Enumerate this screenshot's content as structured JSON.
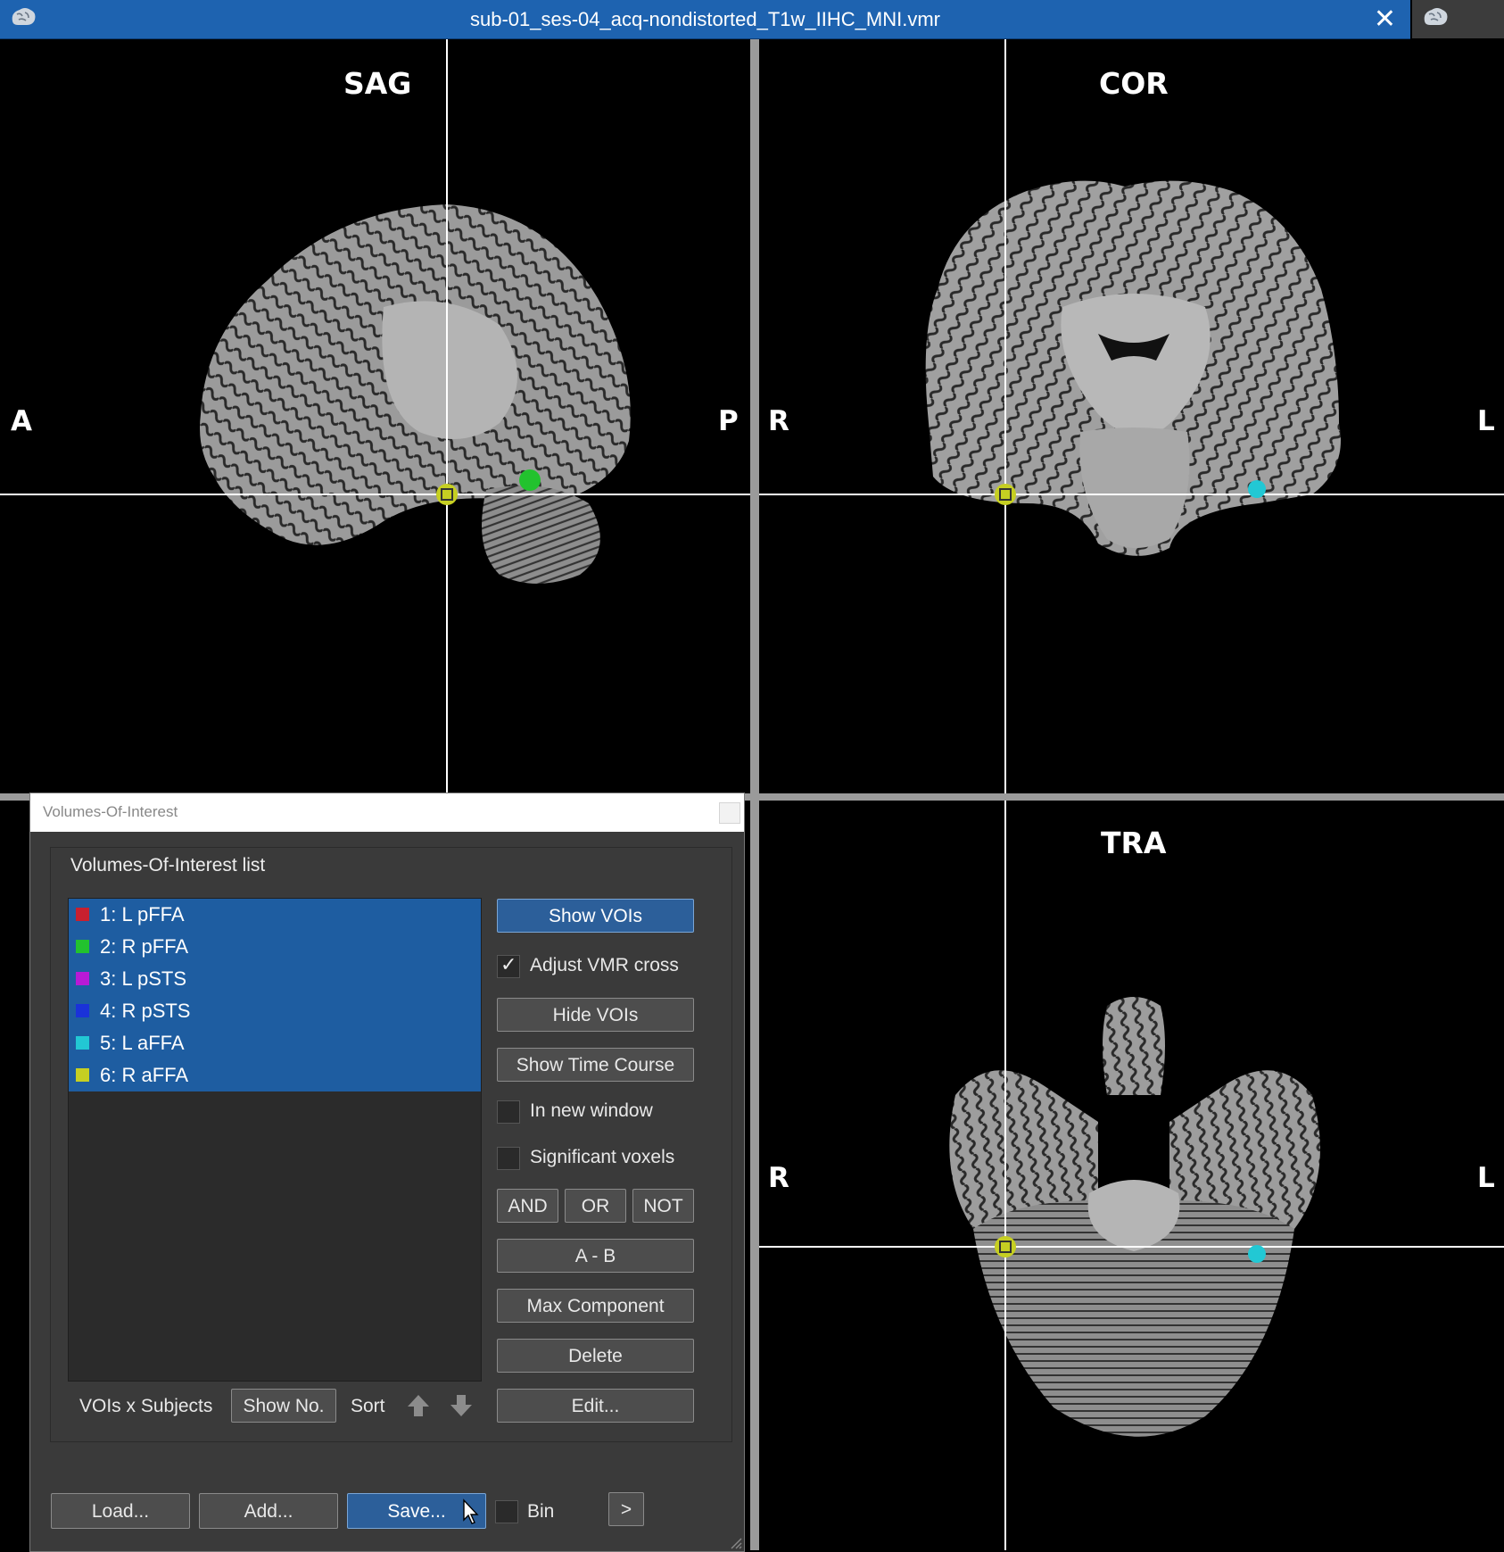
{
  "window": {
    "title": "sub-01_ses-04_acq-nondistorted_T1w_IIHC_MNI.vmr",
    "close_glyph": "✕",
    "app_icon": "brain-icon"
  },
  "views": {
    "sagittal": {
      "label": "SAG",
      "left": "A",
      "right": "P"
    },
    "coronal": {
      "label": "COR",
      "left": "R",
      "right": "L"
    },
    "transversal": {
      "label": "TRA",
      "left": "R",
      "right": "L"
    }
  },
  "voi_dialog": {
    "title": "Volumes-Of-Interest",
    "group_title": "Volumes-Of-Interest list",
    "items": [
      {
        "label": "1: L pFFA",
        "color": "#c8202f"
      },
      {
        "label": "2: R pFFA",
        "color": "#22c22e"
      },
      {
        "label": "3: L pSTS",
        "color": "#b81ad6"
      },
      {
        "label": "4: R pSTS",
        "color": "#1a32d9"
      },
      {
        "label": "5: L aFFA",
        "color": "#22c8d4"
      },
      {
        "label": "6: R aFFA",
        "color": "#c6cf22"
      }
    ],
    "buttons": {
      "show_vois": "Show VOIs",
      "hide_vois": "Hide VOIs",
      "show_time_course": "Show Time Course",
      "and": "AND",
      "or": "OR",
      "not": "NOT",
      "a_minus_b": "A - B",
      "max_component": "Max Component",
      "delete": "Delete",
      "edit": "Edit...",
      "show_no": "Show No.",
      "load": "Load...",
      "add": "Add...",
      "save": "Save...",
      "more": ">"
    },
    "checkboxes": {
      "adjust_vmr_cross": {
        "label": "Adjust VMR cross",
        "checked": true,
        "mark": "✓"
      },
      "in_new_window": {
        "label": "In new window",
        "checked": false
      },
      "significant_voxels": {
        "label": "Significant voxels",
        "checked": false
      },
      "bin": {
        "label": "Bin",
        "checked": false
      }
    },
    "vois_x_subjects": "VOIs x Subjects",
    "sort": "Sort"
  },
  "colors": {
    "title_bar": "#1e63b0",
    "selection": "#1e5da1",
    "crosshair_marker": "#c6cf22"
  }
}
